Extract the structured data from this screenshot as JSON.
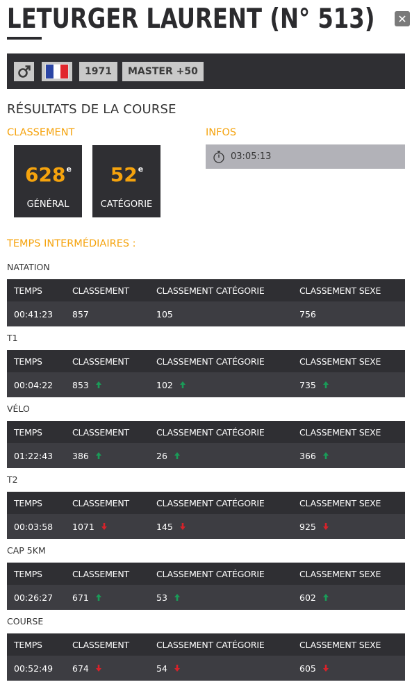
{
  "athlete": {
    "title": "LETURGER LAURENT (N° 513)",
    "gender_icon": "male-icon",
    "nationality_flag": "france-flag",
    "flag_colors": [
      "#2b45a5",
      "#ffffff",
      "#e1262d"
    ],
    "birth_year": "1971",
    "category": "MASTER +50"
  },
  "colors": {
    "accent": "#f5a30d",
    "dark": "#2f2f33",
    "arrow_up": "#1a9b58",
    "arrow_down": "#d7222a"
  },
  "results": {
    "heading": "RÉSULTATS DE LA COURSE",
    "ranking_label": "CLASSEMENT",
    "infos_label": "INFOS",
    "general": {
      "value": "628",
      "suffix": "e",
      "label": "GÉNÉRAL"
    },
    "category": {
      "value": "52",
      "suffix": "e",
      "label": "CATÉGORIE"
    },
    "total_time": "03:05:13",
    "timer_icon": "stopwatch-icon"
  },
  "splits_heading": "TEMPS INTERMÉDIAIRES :",
  "columns": [
    "TEMPS",
    "CLASSEMENT",
    "CLASSEMENT CATÉGORIE",
    "CLASSEMENT SEXE"
  ],
  "splits": [
    {
      "name": "NATATION",
      "time": "00:41:23",
      "rank": "857",
      "rank_trend": "",
      "cat": "105",
      "cat_trend": "",
      "sex": "756",
      "sex_trend": ""
    },
    {
      "name": "T1",
      "time": "00:04:22",
      "rank": "853",
      "rank_trend": "up",
      "cat": "102",
      "cat_trend": "up",
      "sex": "735",
      "sex_trend": "up"
    },
    {
      "name": "VÉLO",
      "time": "01:22:43",
      "rank": "386",
      "rank_trend": "up",
      "cat": "26",
      "cat_trend": "up",
      "sex": "366",
      "sex_trend": "up"
    },
    {
      "name": "T2",
      "time": "00:03:58",
      "rank": "1071",
      "rank_trend": "down",
      "cat": "145",
      "cat_trend": "down",
      "sex": "925",
      "sex_trend": "down"
    },
    {
      "name": "CAP 5KM",
      "time": "00:26:27",
      "rank": "671",
      "rank_trend": "up",
      "cat": "53",
      "cat_trend": "up",
      "sex": "602",
      "sex_trend": "up"
    },
    {
      "name": "COURSE",
      "time": "00:52:49",
      "rank": "674",
      "rank_trend": "down",
      "cat": "54",
      "cat_trend": "down",
      "sex": "605",
      "sex_trend": "down"
    }
  ]
}
